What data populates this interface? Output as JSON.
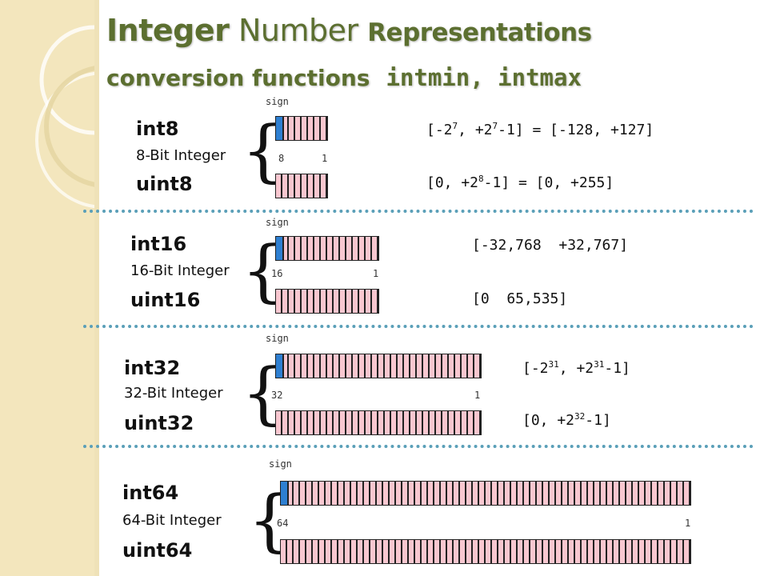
{
  "title": {
    "word1": "Integer",
    "word2": "Number",
    "word3": "Representations",
    "line2_text": "conversion functions",
    "line2_code": "intmin, intmax"
  },
  "rows": {
    "int8": {
      "signed_label": "int8",
      "description": "8-Bit Integer",
      "unsigned_label": "uint8",
      "sign_label": "sign",
      "msb_index": "8",
      "lsb_index": "1"
    },
    "int16": {
      "signed_label": "int16",
      "description": "16-Bit Integer",
      "unsigned_label": "uint16",
      "sign_label": "sign",
      "msb_index": "16",
      "lsb_index": "1",
      "signed_range": "[-32,768  +32,767]",
      "unsigned_range": "[0  65,535]"
    },
    "int32": {
      "signed_label": "int32",
      "description": "32-Bit Integer",
      "unsigned_label": "uint32",
      "sign_label": "sign",
      "msb_index": "32",
      "lsb_index": "1"
    },
    "int64": {
      "signed_label": "int64",
      "description": "64-Bit Integer",
      "unsigned_label": "uint64",
      "sign_label": "sign",
      "msb_index": "64",
      "lsb_index": "1"
    }
  },
  "ranges": {
    "int8_signed": {
      "p1": "[-2",
      "e1": "7",
      "p2": ", +2",
      "e2": "7",
      "p3": "-1] = [-128, +127]"
    },
    "int8_unsigned": {
      "p1": "[0, +2",
      "e1": "8",
      "p2": "-1] = [0, +255]"
    },
    "int32_signed": {
      "p1": "[-2",
      "e1": "31",
      "p2": ", +2",
      "e2": "31",
      "p3": "-1]"
    },
    "int32_unsigned": {
      "p1": "[0, +2",
      "e1": "32",
      "p2": "-1]"
    }
  },
  "colors": {
    "title": "#5c6f30",
    "bit_fill": "#f9c7d0",
    "sign_bit": "#2e7fd1",
    "separator": "#5a9fb8",
    "sidebar": "#f3e6bd"
  },
  "brace_glyph": "{"
}
